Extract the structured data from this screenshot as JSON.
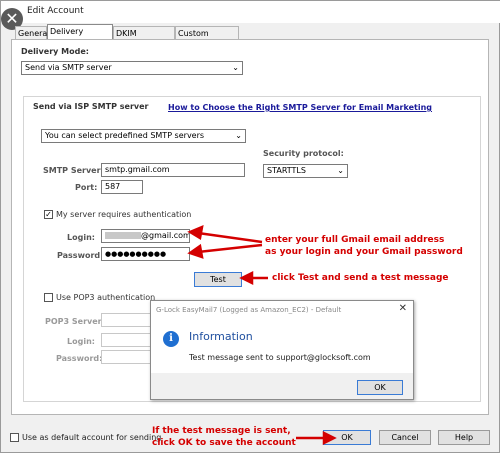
{
  "window": {
    "title": "Edit Account"
  },
  "tabs": [
    "General",
    "Delivery Options",
    "DKIM Signature",
    "Custom Headers"
  ],
  "delivery": {
    "mode_label": "Delivery Mode:",
    "mode_value": "Send via SMTP server",
    "section_label": "Send via ISP SMTP server",
    "help_link": "How to Choose the Right SMTP Server for Email Marketing",
    "predefined_value": "You can select predefined SMTP servers",
    "smtp_server_label": "SMTP Server:",
    "smtp_server_value": "smtp.gmail.com",
    "port_label": "Port:",
    "port_value": "587",
    "security_label": "Security protocol:",
    "security_value": "STARTTLS",
    "auth_label": "My server requires authentication",
    "auth_checked": true,
    "login_label": "Login:",
    "login_value": "@gmail.com",
    "password_label": "Password:",
    "password_value": "●●●●●●●●●●",
    "test_button": "Test",
    "pop3_label": "Use POP3 authentication",
    "pop3_checked": false,
    "pop3_server_label": "POP3 Server:",
    "pop3_login_label": "Login:",
    "pop3_password_label": "Password:"
  },
  "footer": {
    "default_label": "Use as default account for sending",
    "ok": "OK",
    "cancel": "Cancel",
    "help": "Help"
  },
  "dialog": {
    "title": "G-Lock EasyMail7 (Logged as Amazon_EC2) - Default",
    "heading": "Information",
    "message": "Test message sent to support@glocksoft.com",
    "ok": "OK"
  },
  "annotations": {
    "login_line1": "enter your full Gmail email address",
    "login_line2": "as your login and your Gmail password",
    "test": "click Test and send a test message",
    "ok_line1": "If the test message is sent,",
    "ok_line2": "click OK to save the account"
  },
  "colors": {
    "annotation": "#d40000",
    "link": "#1a1a9a",
    "info_icon": "#1f6fd1"
  }
}
